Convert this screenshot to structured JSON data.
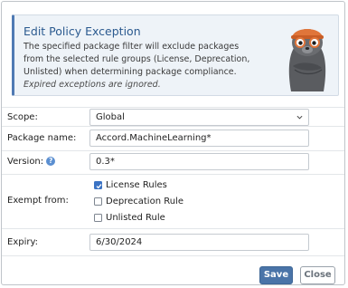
{
  "dialog": {
    "title": "Edit Policy Exception",
    "description": "The specified package filter will exclude packages from the selected rule groups (License, Deprecation, Unlisted) when determining package compliance.",
    "note": "Expired exceptions are ignored.",
    "mascot_icon": "seal-mascot-icon"
  },
  "form": {
    "scope": {
      "label": "Scope:",
      "value": "Global"
    },
    "package_name": {
      "label": "Package name:",
      "value": "Accord.MachineLearning*"
    },
    "version": {
      "label": "Version:",
      "help_icon": "question-icon",
      "help_glyph": "?",
      "value": "0.3*"
    },
    "exempt_from": {
      "label": "Exempt from:",
      "options": [
        {
          "label": "License Rules",
          "checked": true
        },
        {
          "label": "Deprecation Rule",
          "checked": false
        },
        {
          "label": "Unlisted Rule",
          "checked": false
        }
      ]
    },
    "expiry": {
      "label": "Expiry:",
      "value": "6/30/2024"
    }
  },
  "buttons": {
    "save": "Save",
    "close": "Close"
  },
  "colors": {
    "primary": "#4a74a8",
    "info_accent": "#4f7ab3",
    "title": "#2b5a8f",
    "checkbox_checked": "#3b73c4",
    "help_icon": "#5b8fd1"
  }
}
